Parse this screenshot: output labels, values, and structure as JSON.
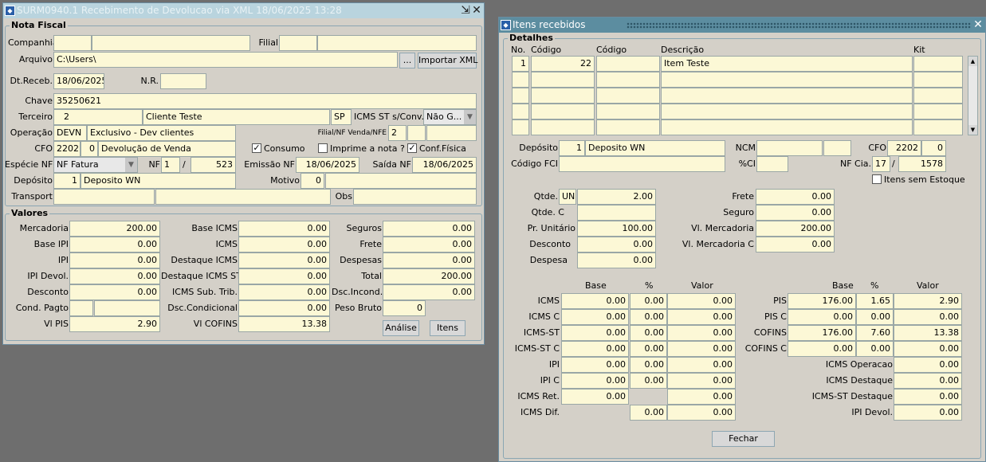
{
  "w1": {
    "title": "SURM0940.1    Recebimento de Devolucao via XML    18/06/2025 13:28",
    "nf_group": "Nota Fiscal",
    "l_companhia": "Companhia",
    "l_filial": "Filial",
    "l_arquivo": "Arquivo",
    "arquivo": "C:\\Users\\",
    "btn_browse": "...",
    "btn_import": "Importar XML",
    "l_dtreceb": "Dt.Receb.",
    "dtreceb": "18/06/2025",
    "l_nr": "N.R.",
    "l_chave": "Chave",
    "chave": "35250621",
    "l_terceiro": "Terceiro",
    "terceiro_cod": "2",
    "terceiro_nome": "Cliente Teste",
    "terceiro_uf": "SP",
    "l_icmsst": "ICMS ST s/Conv.",
    "icmsst": "Não G...",
    "l_operacao": "Operação",
    "operacao_cod": "DEVN",
    "operacao_desc": "Exclusivo - Dev clientes",
    "l_filialnf": "Filial/NF Venda/NFE",
    "filialnf": "2",
    "l_cfo": "CFO",
    "cfo": "2202",
    "cfo2": "0",
    "cfo_desc": "Devolução de Venda",
    "chk_consumo": "Consumo",
    "chk_imprime": "Imprime a nota ?",
    "chk_conf": "Conf.Física",
    "l_especie": "Espécie NF",
    "especie": "NF Fatura",
    "l_nf": "NF",
    "nf_serie": "1",
    "nf_sep": "/",
    "nf_num": "523",
    "l_emissao": "Emissão NF",
    "emissao": "18/06/2025",
    "l_saida": "Saída NF",
    "saida": "18/06/2025",
    "l_deposito": "Depósito",
    "deposito_cod": "1",
    "deposito_nome": "Deposito WN",
    "l_motivo": "Motivo",
    "motivo": "0",
    "l_transport": "Transport",
    "l_obs": "Obs",
    "val_group": "Valores",
    "l_mercadoria": "Mercadoria",
    "mercadoria": "200.00",
    "l_baseipi": "Base IPI",
    "baseipi": "0.00",
    "l_ipi": "IPI",
    "ipi": "0.00",
    "l_ipidevol": "IPI Devol.",
    "ipidevol": "0.00",
    "l_desconto": "Desconto",
    "desconto": "0.00",
    "l_condpagto": "Cond. Pagto",
    "l_vipis": "Vl PIS",
    "vipis": "2.90",
    "l_baseicms": "Base ICMS",
    "baseicms": "0.00",
    "l_icms": "ICMS",
    "icms": "0.00",
    "l_destaqueicms": "Destaque ICMS",
    "destaqueicms": "0.00",
    "l_destaqueicmsst": "Destaque ICMS ST",
    "destaqueicmsst": "0.00",
    "l_icmssub": "ICMS Sub. Trib.",
    "icmssub": "0.00",
    "l_dsccond": "Dsc.Condicional",
    "dsccond": "0.00",
    "l_vicofins": "Vl COFINS",
    "vicofins": "13.38",
    "l_seguros": "Seguros",
    "seguros": "0.00",
    "l_frete": "Frete",
    "frete": "0.00",
    "l_despesas": "Despesas",
    "despesas": "0.00",
    "l_total": "Total",
    "total": "200.00",
    "l_dscincond": "Dsc.Incond.",
    "dscincond": "0.00",
    "l_pesobruto": "Peso Bruto",
    "pesobruto": "0",
    "btn_analise": "Análise",
    "btn_itens": "Itens"
  },
  "w2": {
    "title": "Itens recebidos",
    "det_group": "Detalhes",
    "h_no": "No.",
    "h_cod1": "Código",
    "h_cod2": "Código",
    "h_desc": "Descrição",
    "h_kit": "Kit",
    "row1_no": "1",
    "row1_cod": "22",
    "row1_desc": "Item Teste",
    "l_deposito": "Depósito",
    "deposito_cod": "1",
    "deposito_nome": "Deposito WN",
    "l_ncm": "NCM",
    "l_cfo": "CFO",
    "cfo": "2202",
    "cfo2": "0",
    "l_fci": "Código FCI",
    "l_pci": "%CI",
    "l_nfcia": "NF Cia.",
    "nfcia_serie": "17",
    "nfcia_sep": "/",
    "nfcia_num": "1578",
    "chk_semestoque": "Itens sem Estoque",
    "l_qtde": "Qtde.",
    "qtde_un": "UN",
    "qtde": "2.00",
    "l_qtdec": "Qtde. C",
    "l_prunit": "Pr. Unitário",
    "prunit": "100.00",
    "l_desconto": "Desconto",
    "desconto": "0.00",
    "l_despesa": "Despesa",
    "despesa": "0.00",
    "l_frete": "Frete",
    "frete": "0.00",
    "l_seguro": "Seguro",
    "seguro": "0.00",
    "l_vlmerc": "Vl. Mercadoria",
    "vlmerc": "200.00",
    "l_vlmercc": "Vl. Mercadoria C",
    "vlmercc": "0.00",
    "h_base": "Base",
    "h_pct": "%",
    "h_valor": "Valor",
    "h_base2": "Base",
    "h_pct2": "%",
    "h_valor2": "Valor",
    "tax_left": [
      {
        "label": "ICMS",
        "base": "0.00",
        "pct": "0.00",
        "valor": "0.00"
      },
      {
        "label": "ICMS C",
        "base": "0.00",
        "pct": "0.00",
        "valor": "0.00"
      },
      {
        "label": "ICMS-ST",
        "base": "0.00",
        "pct": "0.00",
        "valor": "0.00"
      },
      {
        "label": "ICMS-ST C",
        "base": "0.00",
        "pct": "0.00",
        "valor": "0.00"
      },
      {
        "label": "IPI",
        "base": "0.00",
        "pct": "0.00",
        "valor": "0.00"
      },
      {
        "label": "IPI C",
        "base": "0.00",
        "pct": "0.00",
        "valor": "0.00"
      }
    ],
    "l_icmsret": "ICMS Ret.",
    "icmsret_base": "0.00",
    "icmsret_valor": "0.00",
    "l_icmsdif": "ICMS Dif.",
    "icmsdif_pct": "0.00",
    "icmsdif_valor": "0.00",
    "tax_right": [
      {
        "label": "PIS",
        "base": "176.00",
        "pct": "1.65",
        "valor": "2.90"
      },
      {
        "label": "PIS C",
        "base": "0.00",
        "pct": "0.00",
        "valor": "0.00"
      },
      {
        "label": "COFINS",
        "base": "176.00",
        "pct": "7.60",
        "valor": "13.38"
      },
      {
        "label": "COFINS C",
        "base": "0.00",
        "pct": "0.00",
        "valor": "0.00"
      }
    ],
    "l_icmsop": "ICMS Operacao",
    "icmsop": "0.00",
    "l_icmsdest": "ICMS Destaque",
    "icmsdest": "0.00",
    "l_icmsstdest": "ICMS-ST Destaque",
    "icmsstdest": "0.00",
    "l_ipidevol": "IPI Devol.",
    "ipidevol": "0.00",
    "btn_fechar": "Fechar"
  }
}
